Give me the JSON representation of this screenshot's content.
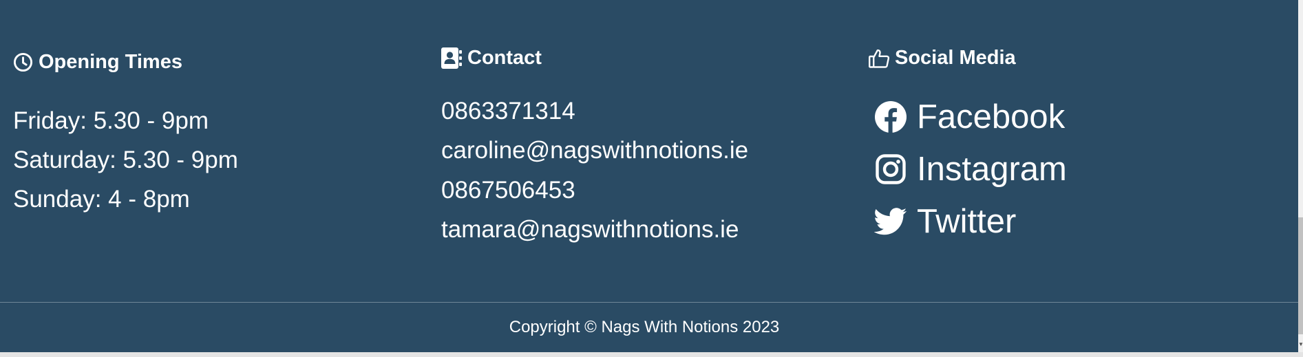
{
  "colors": {
    "footer_bg": "#2a4b64",
    "text": "#ffffff",
    "divider": "#6f8798"
  },
  "opening": {
    "icon": "clock-icon",
    "title": "Opening Times",
    "hours": [
      "Friday: 5.30 - 9pm",
      "Saturday: 5.30 - 9pm",
      "Sunday: 4 - 8pm"
    ]
  },
  "contact": {
    "icon": "address-book-icon",
    "title": "Contact",
    "lines": [
      "0863371314",
      "caroline@nagswithnotions.ie",
      "0867506453",
      "tamara@nagswithnotions.ie"
    ]
  },
  "social": {
    "icon": "thumbs-up-icon",
    "title": "Social Media",
    "links": [
      {
        "label": "Facebook",
        "icon": "facebook-icon"
      },
      {
        "label": "Instagram",
        "icon": "instagram-icon"
      },
      {
        "label": "Twitter",
        "icon": "twitter-icon"
      }
    ]
  },
  "footer": {
    "copyright": "Copyright © Nags With Notions 2023"
  }
}
